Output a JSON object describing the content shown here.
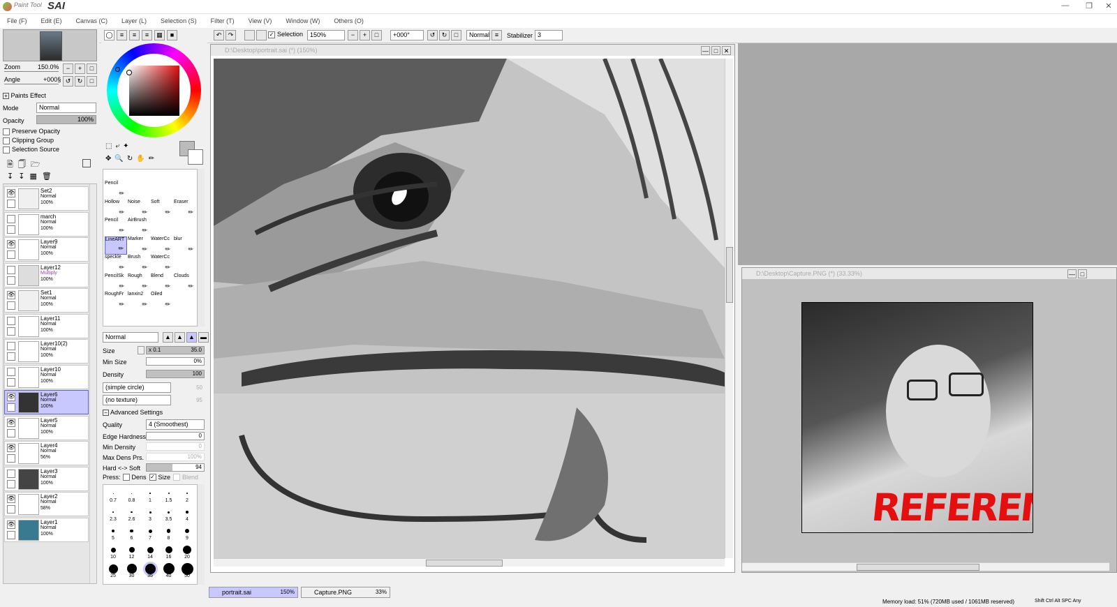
{
  "app": {
    "title_small": "Paint Tool",
    "title_big": "SAI"
  },
  "menu": [
    "File (F)",
    "Edit (E)",
    "Canvas (C)",
    "Layer (L)",
    "Selection (S)",
    "Filter (T)",
    "View (V)",
    "Window (W)",
    "Others (O)"
  ],
  "toolbar": {
    "selection_label": "Selection",
    "zoom": "150%",
    "rotate": "+000°",
    "mode": "Normal",
    "stabilizer_label": "Stabilizer",
    "stabilizer_value": "3"
  },
  "navigator": {
    "zoom_label": "Zoom",
    "zoom_value": "150.0%",
    "angle_label": "Angle",
    "angle_value": "+000§"
  },
  "layer_props": {
    "paints_effect": "Paints Effect",
    "mode_label": "Mode",
    "mode_value": "Normal",
    "opacity_label": "Opacity",
    "opacity_value": "100%",
    "preserve_opacity": "Preserve Opacity",
    "clipping_group": "Clipping Group",
    "selection_source": "Selection Source"
  },
  "layers": [
    {
      "name": "Set2",
      "mode": "Normal",
      "opacity": "100%",
      "folder": true
    },
    {
      "name": "march",
      "mode": "Normal",
      "opacity": "100%"
    },
    {
      "name": "Layer9",
      "mode": "Normal",
      "opacity": "100%"
    },
    {
      "name": "Layer12",
      "mode": "Multiply",
      "opacity": "100%"
    },
    {
      "name": "Set1",
      "mode": "Normal",
      "opacity": "100%",
      "folder": true
    },
    {
      "name": "Layer11",
      "mode": "Normal",
      "opacity": "100%"
    },
    {
      "name": "Layer10(2)",
      "mode": "Normal",
      "opacity": "100%"
    },
    {
      "name": "Layer10",
      "mode": "Normal",
      "opacity": "100%"
    },
    {
      "name": "Layer6",
      "mode": "Normal",
      "opacity": "100%",
      "selected": true
    },
    {
      "name": "Layer5",
      "mode": "Normal",
      "opacity": "100%"
    },
    {
      "name": "Layer4",
      "mode": "Normal",
      "opacity": "56%"
    },
    {
      "name": "Layer3",
      "mode": "Normal",
      "opacity": "100%"
    },
    {
      "name": "Layer2",
      "mode": "Normal",
      "opacity": "58%"
    },
    {
      "name": "Layer1",
      "mode": "Normal",
      "opacity": "100%"
    }
  ],
  "tools": [
    "Pencil",
    "Hollow",
    "Noise",
    "Soft",
    "Eraser",
    "Pencil",
    "AirBrush",
    "LineART",
    "Marker",
    "WaterCc",
    "blur",
    "speckle",
    "Brush",
    "WaterCc",
    "PencilSk",
    "Rough",
    "Blend",
    "Clouds",
    "RoughFr",
    "lanxin2",
    "Oiled"
  ],
  "brush_settings": {
    "mode": "Normal",
    "size_label": "Size",
    "size_mult": "x 0.1",
    "size_value": "35.0",
    "min_size_label": "Min Size",
    "min_size_value": "0%",
    "density_label": "Density",
    "density_value": "100",
    "shape": "(simple circle)",
    "shape_val": "50",
    "texture": "(no texture)",
    "texture_val": "95",
    "advanced": "Advanced Settings",
    "quality_label": "Quality",
    "quality_value": "4 (Smoothest)",
    "edge_label": "Edge Hardness",
    "edge_value": "0",
    "min_dens_label": "Min Density",
    "min_dens_value": "0",
    "max_dens_label": "Max Dens Prs.",
    "max_dens_value": "100%",
    "hardsoft_label": "Hard <-> Soft",
    "hardsoft_value": "94",
    "press_label": "Press:",
    "press_dens": "Dens",
    "press_size": "Size",
    "press_blend": "Blend"
  },
  "brush_sizes": [
    "0.7",
    "0.8",
    "1",
    "1.5",
    "2",
    "2.3",
    "2.6",
    "3",
    "3.5",
    "4",
    "5",
    "6",
    "7",
    "8",
    "9",
    "10",
    "12",
    "14",
    "16",
    "20",
    "25",
    "30",
    "35",
    "40",
    "50"
  ],
  "canvas1": {
    "title": "D:\\Desktop\\portrait.sai (*) (150%)"
  },
  "canvas2": {
    "title": "D:\\Desktop\\Capture.PNG (*) (33.33%)",
    "reference_text": "REFERENCE"
  },
  "tabs": [
    {
      "name": "portrait.sai",
      "zoom": "150%"
    },
    {
      "name": "Capture.PNG",
      "zoom": "33%"
    }
  ],
  "status": {
    "memory": "Memory load: 51% (720MB used / 1061MB reserved)",
    "keys": "Shift Ctrl Alt SPC  Any"
  }
}
